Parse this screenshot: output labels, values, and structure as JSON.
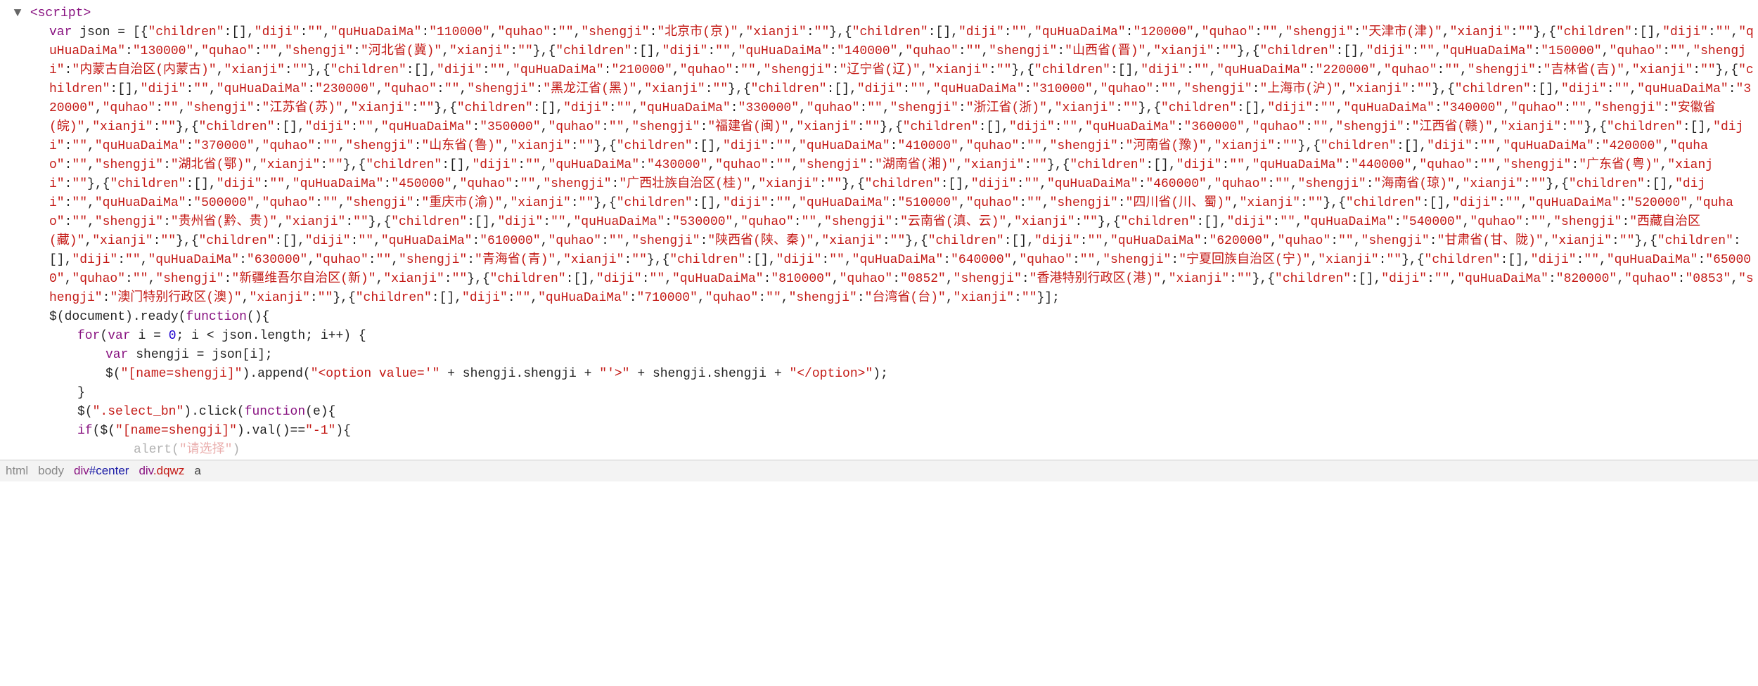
{
  "script_tag": "<script>",
  "var_decl_prefix": "var json = ",
  "json_data": [
    {
      "children": [],
      "diji": "",
      "quHuaDaiMa": "110000",
      "quhao": "",
      "shengji": "北京市(京)",
      "xianji": ""
    },
    {
      "children": [],
      "diji": "",
      "quHuaDaiMa": "120000",
      "quhao": "",
      "shengji": "天津市(津)",
      "xianji": ""
    },
    {
      "children": [],
      "diji": "",
      "quHuaDaiMa": "130000",
      "quhao": "",
      "shengji": "河北省(冀)",
      "xianji": ""
    },
    {
      "children": [],
      "diji": "",
      "quHuaDaiMa": "140000",
      "quhao": "",
      "shengji": "山西省(晋)",
      "xianji": ""
    },
    {
      "children": [],
      "diji": "",
      "quHuaDaiMa": "150000",
      "quhao": "",
      "shengji": "内蒙古自治区(内蒙古)",
      "xianji": ""
    },
    {
      "children": [],
      "diji": "",
      "quHuaDaiMa": "210000",
      "quhao": "",
      "shengji": "辽宁省(辽)",
      "xianji": ""
    },
    {
      "children": [],
      "diji": "",
      "quHuaDaiMa": "220000",
      "quhao": "",
      "shengji": "吉林省(吉)",
      "xianji": ""
    },
    {
      "children": [],
      "diji": "",
      "quHuaDaiMa": "230000",
      "quhao": "",
      "shengji": "黑龙江省(黑)",
      "xianji": ""
    },
    {
      "children": [],
      "diji": "",
      "quHuaDaiMa": "310000",
      "quhao": "",
      "shengji": "上海市(沪)",
      "xianji": ""
    },
    {
      "children": [],
      "diji": "",
      "quHuaDaiMa": "320000",
      "quhao": "",
      "shengji": "江苏省(苏)",
      "xianji": ""
    },
    {
      "children": [],
      "diji": "",
      "quHuaDaiMa": "330000",
      "quhao": "",
      "shengji": "浙江省(浙)",
      "xianji": ""
    },
    {
      "children": [],
      "diji": "",
      "quHuaDaiMa": "340000",
      "quhao": "",
      "shengji": "安徽省(皖)",
      "xianji": ""
    },
    {
      "children": [],
      "diji": "",
      "quHuaDaiMa": "350000",
      "quhao": "",
      "shengji": "福建省(闽)",
      "xianji": ""
    },
    {
      "children": [],
      "diji": "",
      "quHuaDaiMa": "360000",
      "quhao": "",
      "shengji": "江西省(赣)",
      "xianji": ""
    },
    {
      "children": [],
      "diji": "",
      "quHuaDaiMa": "370000",
      "quhao": "",
      "shengji": "山东省(鲁)",
      "xianji": ""
    },
    {
      "children": [],
      "diji": "",
      "quHuaDaiMa": "410000",
      "quhao": "",
      "shengji": "河南省(豫)",
      "xianji": ""
    },
    {
      "children": [],
      "diji": "",
      "quHuaDaiMa": "420000",
      "quhao": "",
      "shengji": "湖北省(鄂)",
      "xianji": ""
    },
    {
      "children": [],
      "diji": "",
      "quHuaDaiMa": "430000",
      "quhao": "",
      "shengji": "湖南省(湘)",
      "xianji": ""
    },
    {
      "children": [],
      "diji": "",
      "quHuaDaiMa": "440000",
      "quhao": "",
      "shengji": "广东省(粤)",
      "xianji": ""
    },
    {
      "children": [],
      "diji": "",
      "quHuaDaiMa": "450000",
      "quhao": "",
      "shengji": "广西壮族自治区(桂)",
      "xianji": ""
    },
    {
      "children": [],
      "diji": "",
      "quHuaDaiMa": "460000",
      "quhao": "",
      "shengji": "海南省(琼)",
      "xianji": ""
    },
    {
      "children": [],
      "diji": "",
      "quHuaDaiMa": "500000",
      "quhao": "",
      "shengji": "重庆市(渝)",
      "xianji": ""
    },
    {
      "children": [],
      "diji": "",
      "quHuaDaiMa": "510000",
      "quhao": "",
      "shengji": "四川省(川、蜀)",
      "xianji": ""
    },
    {
      "children": [],
      "diji": "",
      "quHuaDaiMa": "520000",
      "quhao": "",
      "shengji": "贵州省(黔、贵)",
      "xianji": ""
    },
    {
      "children": [],
      "diji": "",
      "quHuaDaiMa": "530000",
      "quhao": "",
      "shengji": "云南省(滇、云)",
      "xianji": ""
    },
    {
      "children": [],
      "diji": "",
      "quHuaDaiMa": "540000",
      "quhao": "",
      "shengji": "西藏自治区(藏)",
      "xianji": ""
    },
    {
      "children": [],
      "diji": "",
      "quHuaDaiMa": "610000",
      "quhao": "",
      "shengji": "陕西省(陕、秦)",
      "xianji": ""
    },
    {
      "children": [],
      "diji": "",
      "quHuaDaiMa": "620000",
      "quhao": "",
      "shengji": "甘肃省(甘、陇)",
      "xianji": ""
    },
    {
      "children": [],
      "diji": "",
      "quHuaDaiMa": "630000",
      "quhao": "",
      "shengji": "青海省(青)",
      "xianji": ""
    },
    {
      "children": [],
      "diji": "",
      "quHuaDaiMa": "640000",
      "quhao": "",
      "shengji": "宁夏回族自治区(宁)",
      "xianji": ""
    },
    {
      "children": [],
      "diji": "",
      "quHuaDaiMa": "650000",
      "quhao": "",
      "shengji": "新疆维吾尔自治区(新)",
      "xianji": ""
    },
    {
      "children": [],
      "diji": "",
      "quHuaDaiMa": "810000",
      "quhao": "0852",
      "shengji": "香港特别行政区(港)",
      "xianji": ""
    },
    {
      "children": [],
      "diji": "",
      "quHuaDaiMa": "820000",
      "quhao": "0853",
      "shengji": "澳门特别行政区(澳)",
      "xianji": ""
    },
    {
      "children": [],
      "diji": "",
      "quHuaDaiMa": "710000",
      "quhao": "",
      "shengji": "台湾省(台)",
      "xianji": ""
    }
  ],
  "code_lines": {
    "ready_open": "$(document).ready(function(){",
    "for_open": "for(var i = 0; i < json.length; i++) {",
    "var_shengji": "var shengji = json[i];",
    "append_line": "$(\"[name=shengji]\").append(\"<option value='\" + shengji.shengji + \"'>\" + shengji.shengji + \"</option>\");",
    "for_close": "}",
    "click_open": "$(\".select_bn\").click(function(e){",
    "if_open": "if($(\"[name=shengji]\").val()==\"-1\"){",
    "alert_partial": "alert(\"请选择\")"
  },
  "breadcrumb": {
    "html": "html",
    "body": "body",
    "div_center": "div#center",
    "div_dqwz": "div.dqwz",
    "a": "a"
  }
}
